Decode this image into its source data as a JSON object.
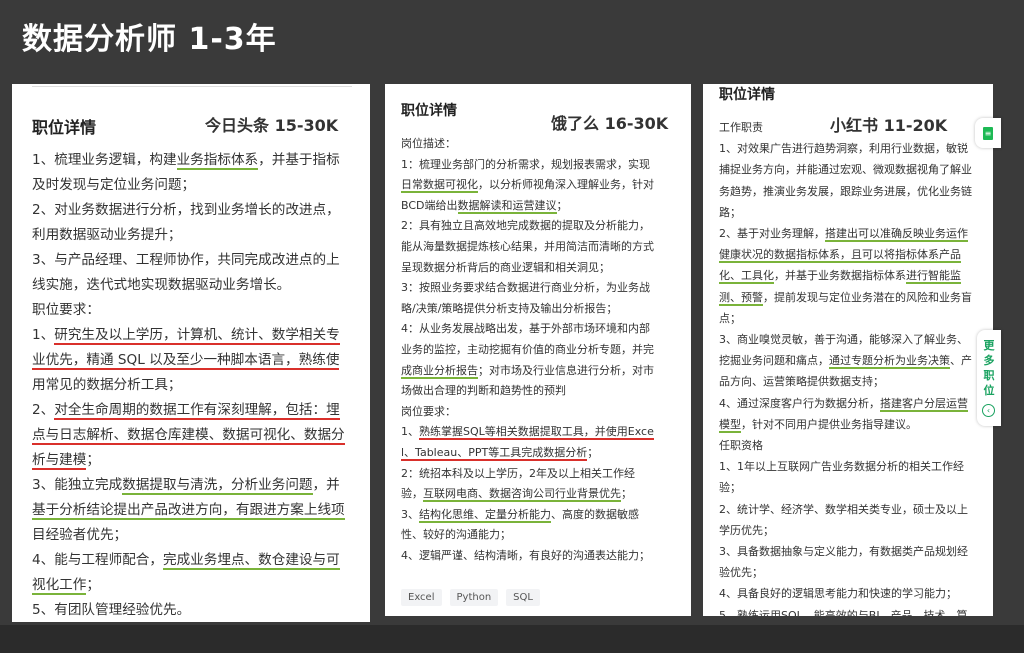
{
  "slide": {
    "title": "数据分析师 1-3年"
  },
  "cards": [
    {
      "header": "职位详情",
      "company": "今日头条  15-30K",
      "lines": [
        [
          "1、梳理业务逻辑，构建",
          {
            "t": "业务指标体系",
            "u": "green"
          },
          "，并基于指标"
        ],
        [
          "及时发现与定位业务问题；"
        ],
        [
          "2、对业务数据进行分析，找到业务增长的改进点，"
        ],
        [
          "利用数据驱动业务提升；"
        ],
        [
          "3、与产品经理、工程师协作，共同完成改进点的上"
        ],
        [
          "线实施，迭代式地实现数据驱动业务增长。"
        ],
        [
          "职位要求："
        ],
        [
          "1、",
          {
            "t": "研究生及以上学历，计算机、统计、数学相关专",
            "u": "red"
          }
        ],
        [
          {
            "t": "业优先，精通 SQL 以及至少一种脚本语言，熟练使",
            "u": "red"
          }
        ],
        [
          "用常见的数据分析工具；"
        ],
        [
          "2、",
          {
            "t": "对全生命周期的数据工作有深刻理解，包括：埋",
            "u": "red"
          }
        ],
        [
          {
            "t": "点与日志解析、数据仓库建模、数据可视化、数据分",
            "u": "red"
          }
        ],
        [
          {
            "t": "析与建模",
            "u": "red"
          },
          "；"
        ],
        [
          "3、能独立完成",
          {
            "t": "数据提取与清洗，分析业务问题",
            "u": "green"
          },
          "，并"
        ],
        [
          {
            "t": "基于分析结论提出产品改进方向，有跟进方案上线项",
            "u": "green"
          }
        ],
        [
          "目经验者优先；"
        ],
        [
          "4、能与工程师配合，",
          {
            "t": "完成业务埋点、数仓建设与可",
            "u": "green"
          }
        ],
        [
          {
            "t": "视化工作",
            "u": "green"
          },
          "；"
        ],
        [
          "5、有团队管理经验优先。"
        ]
      ]
    },
    {
      "header": "职位详情",
      "company": "饿了么  16-30K",
      "lines": [
        [
          "岗位描述："
        ],
        [
          "1：梳理业务部门的分析需求，规划报表需求，实现"
        ],
        [
          {
            "t": "日常数据可视化",
            "u": "green"
          },
          "，以分析师视角深入理解业务，针对"
        ],
        [
          "BCD端给出",
          {
            "t": "数据解读和运营建议",
            "u": "green"
          },
          "；"
        ],
        [
          "2：具有独立且高效地完成数据的提取及分析能力，"
        ],
        [
          "能从海量数据提炼核心结果，并用简洁而清晰的方式"
        ],
        [
          "呈现数据分析背后的商业逻辑和相关洞见；"
        ],
        [
          "3：按照业务要求结合数据进行商业分析，为业务战"
        ],
        [
          "略/决策/策略提供分析支持及输出分析报告；"
        ],
        [
          "4：从业务发展战略出发，基于外部市场环境和内部"
        ],
        [
          "业务的监控，主动挖掘有价值的商业分析专题，并完"
        ],
        [
          {
            "t": "成商业分析报告",
            "u": "green"
          },
          "；对市场及行业信息进行分析，对市"
        ],
        [
          "场做出合理的判断和趋势性的预判"
        ],
        [
          "岗位要求："
        ],
        [
          "1、",
          {
            "t": "熟练掌握SQL等相关数据提取工具，并使用Exce",
            "u": "red"
          }
        ],
        [
          {
            "t": "l、Tableau、PPT等工具完成数据分析",
            "u": "red"
          },
          "；"
        ],
        [
          "2：统招本科及以上学历，2年及以上相关工作经"
        ],
        [
          "验，",
          {
            "t": "互联网电商、数据咨询公司行业背景优先",
            "u": "green"
          },
          "；"
        ],
        [
          "3、",
          {
            "t": "结构化思维、定量分析能力",
            "u": "green"
          },
          "、高度的数据敏感"
        ],
        [
          "性、较好的沟通能力；"
        ],
        [
          "4、逻辑严谨、结构清晰，有良好的沟通表达能力；"
        ]
      ],
      "tags": [
        "Excel",
        "Python",
        "SQL"
      ]
    },
    {
      "header": "职位详情",
      "company": "小红书  11-20K",
      "lines": [
        [
          "工作职责"
        ],
        [
          "1、对效果广告进行趋势洞察，利用行业数据，敏锐"
        ],
        [
          "捕捉业务方向，并能通过宏观、微观数据视角了解业"
        ],
        [
          "务趋势，推演业务发展，跟踪业务进展，优化业务链"
        ],
        [
          "路；"
        ],
        [
          "2、基于对业务理解，",
          {
            "t": "搭建出可以准确反映业务运作",
            "u": "green"
          }
        ],
        [
          {
            "t": "健康状况的数据指标体系，且可以将指标体系产品",
            "u": "green"
          }
        ],
        [
          {
            "t": "化、工具化",
            "u": "green"
          },
          "，并基于业务数据指标体系",
          {
            "t": "进行智能监",
            "u": "green"
          }
        ],
        [
          {
            "t": "测、预警",
            "u": "green"
          },
          "，提前发现与定位业务潜在的风险和业务盲"
        ],
        [
          "点；"
        ],
        [
          "3、商业嗅觉灵敏，善于沟通，能够深入了解业务、"
        ],
        [
          "挖掘业务问题和痛点，",
          {
            "t": "通过专题分析为业务决策",
            "u": "green"
          },
          "、产"
        ],
        [
          "品方向、运营策略提供数据支持；"
        ],
        [
          "4、通过深度客户行为数据分析，",
          {
            "t": "搭建客户分层运营",
            "u": "green"
          }
        ],
        [
          {
            "t": "模型",
            "u": "green"
          },
          "，针对不同用户提供业务指导建议。"
        ],
        [
          "任职资格"
        ],
        [
          "1、1年以上互联网广告业务数据分析的相关工作经"
        ],
        [
          "验；"
        ],
        [
          "2、统计学、经济学、数学相关类专业，硕士及以上"
        ],
        [
          "学历优先；"
        ],
        [
          "3、具备数据抽象与定义能力，有数据类产品规划经"
        ],
        [
          "验优先；"
        ],
        [
          "4、具备良好的逻辑思考能力和快速的学习能力；"
        ],
        [
          "5、",
          {
            "t": "熟练运用SQL，能高效的与BI、产品、技术、算",
            "u": "red"
          }
        ]
      ]
    }
  ],
  "side": {
    "more_label": "更多职位"
  },
  "icons": {
    "doc": "document-icon",
    "arrow": "circle-arrow-left-icon"
  },
  "colors": {
    "underline_green": "#7ab33a",
    "underline_red": "#d9302b",
    "accent": "#1aa260"
  }
}
